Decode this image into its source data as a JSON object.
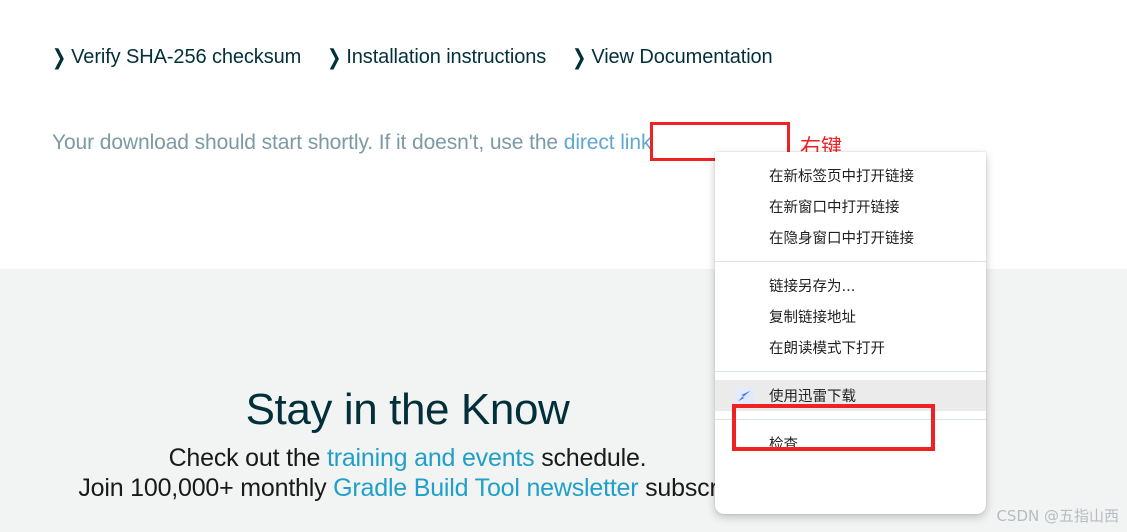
{
  "page": {
    "quick_links": [
      {
        "label": "Verify SHA-256 checksum",
        "icon": "chevron-right-icon"
      },
      {
        "label": "Installation instructions",
        "icon": "chevron-right-icon"
      },
      {
        "label": "View Documentation",
        "icon": "chevron-right-icon"
      }
    ],
    "download_notice": {
      "before": "Your download should start shortly. If it doesn't, use the ",
      "link_text": "direct link",
      "after": ""
    },
    "annotations": {
      "right_click_label": "右键"
    },
    "newsletter": {
      "title": "Stay in the Know",
      "line1_before": "Check out the ",
      "line1_link": "training and events",
      "line1_after": " schedule.",
      "line2_before": "Join 100,000+ monthly ",
      "line2_link": "Gradle Build Tool newsletter",
      "line2_after": " subscrib"
    },
    "watermark": "CSDN @五指山西"
  },
  "context_menu": {
    "groups": [
      {
        "items": [
          {
            "label": "在新标签页中打开链接",
            "icon": "",
            "highlighted": false
          },
          {
            "label": "在新窗口中打开链接",
            "icon": "",
            "highlighted": false
          },
          {
            "label": "在隐身窗口中打开链接",
            "icon": "",
            "highlighted": false
          }
        ]
      },
      {
        "items": [
          {
            "label": "链接另存为...",
            "icon": "",
            "highlighted": false
          },
          {
            "label": "复制链接地址",
            "icon": "",
            "highlighted": false
          },
          {
            "label": "在朗读模式下打开",
            "icon": "",
            "highlighted": false
          }
        ]
      },
      {
        "items": [
          {
            "label": "使用迅雷下载",
            "icon": "xunlei-icon",
            "highlighted": true
          }
        ]
      },
      {
        "items": [
          {
            "label": "检查",
            "icon": "",
            "highlighted": false
          }
        ]
      }
    ]
  },
  "colors": {
    "accent_link": "#20a0c8",
    "heading": "#02303a",
    "annotation_red": "#ee2222",
    "muted_text": "#7b9aa6",
    "band_background": "#f2f3f3"
  }
}
